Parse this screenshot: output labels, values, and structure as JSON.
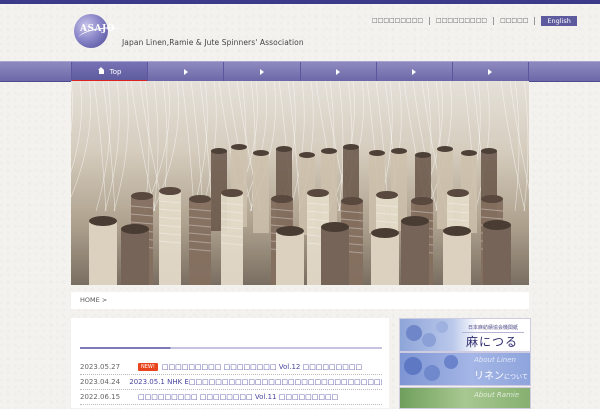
{
  "header": {
    "logo_text": "ASAJO",
    "org_name": "Japan Linen,Ramie & Jute Spinners' Association",
    "util_links": [
      "□□□□□□□□□",
      "□□□□□□□□□",
      "□□□□□"
    ],
    "english_label": "English"
  },
  "nav": {
    "items": [
      {
        "label": "Top",
        "icon": "home-icon",
        "active": true
      },
      {
        "label": "",
        "icon": "arrow-right-icon"
      },
      {
        "label": "",
        "icon": "arrow-right-icon"
      },
      {
        "label": "",
        "icon": "arrow-right-icon"
      },
      {
        "label": "",
        "icon": "arrow-right-icon"
      },
      {
        "label": "",
        "icon": "arrow-right-icon"
      }
    ]
  },
  "breadcrumb": {
    "text": "HOME >"
  },
  "news": {
    "items": [
      {
        "date": "2023.05.27",
        "badge": "NEW!",
        "title": "□□□□□□□□□ □□□□□□□□ Vol.12 □□□□□□□□□"
      },
      {
        "date": "2023.04.24",
        "badge": "",
        "title": "2023.05.1 NHK E□□□□□□□□□□□□□□□□□□□□□□□□□□□□□□□□□□□□"
      },
      {
        "date": "2022.06.15",
        "badge": "",
        "title": "□□□□□□□□□ □□□□□□□□ Vol.11 □□□□□□□□□"
      }
    ]
  },
  "banners": {
    "b1_label": "日本麻紡績協会機関紙",
    "b1_title": "麻につるる",
    "b2_script": "About Linen",
    "b2_title": "リネン",
    "b2_suffix": "について",
    "b3_script": "About Ramie"
  },
  "colors": {
    "nav": "#6c68a8",
    "accent_red": "#dd2222",
    "link": "#4a47a0",
    "badge": "#e8451e"
  }
}
